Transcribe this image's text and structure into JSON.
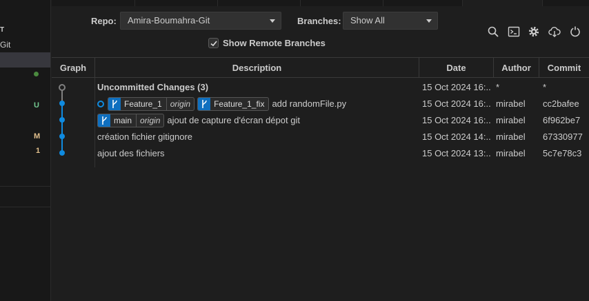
{
  "sidebar": {
    "title": "T",
    "repo_label": "Git",
    "badges": [
      "U",
      "M",
      "1"
    ]
  },
  "controls": {
    "repo_label": "Repo:",
    "repo_value": "Amira-Boumahra-Git",
    "branches_label": "Branches:",
    "branches_value": "Show All",
    "show_remote_label": "Show Remote Branches",
    "show_remote_checked": true
  },
  "toolbar": {
    "icons": [
      "search-icon",
      "terminal-icon",
      "gear-icon",
      "cloud-download-icon",
      "refresh-icon"
    ]
  },
  "table": {
    "headers": {
      "graph": "Graph",
      "description": "Description",
      "date": "Date",
      "author": "Author",
      "commit": "Commit"
    },
    "rows": [
      {
        "description": "Uncommitted Changes (3)",
        "date": "15 Oct 2024 16:...",
        "author": "*",
        "commit": "*"
      },
      {
        "refs": [
          {
            "name": "Feature_1",
            "remote": "origin"
          },
          {
            "name": "Feature_1_fix",
            "remote": ""
          }
        ],
        "description": "add randomFile.py",
        "date": "15 Oct 2024 16:...",
        "author": "mirabel",
        "commit": "cc2bafee"
      },
      {
        "refs": [
          {
            "name": "main",
            "remote": "origin"
          }
        ],
        "description": "ajout de capture d'écran dépot git",
        "date": "15 Oct 2024 16:...",
        "author": "mirabel",
        "commit": "6f962be7"
      },
      {
        "description": "création fichier gitignore",
        "date": "15 Oct 2024 14:...",
        "author": "mirabel",
        "commit": "67330977"
      },
      {
        "description": "ajout des fichiers",
        "date": "15 Oct 2024 13:...",
        "author": "mirabel",
        "commit": "5c7e78c3"
      }
    ]
  },
  "colors": {
    "graph_line": "#0f8be0",
    "uncommitted_node": "#808080",
    "ref_badge": "#0f6fbf"
  }
}
